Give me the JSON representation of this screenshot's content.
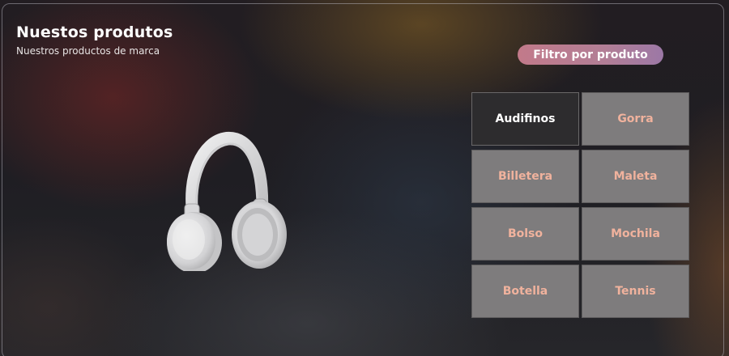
{
  "header": {
    "title": "Nuestos produtos",
    "subtitle": "Nuestros productos de marca"
  },
  "filter_button": {
    "label": "Filtro por produto",
    "gradient": [
      "#c27a8a",
      "#9c78a6"
    ]
  },
  "categories": [
    {
      "label": "Audifinos",
      "active": true
    },
    {
      "label": "Gorra",
      "active": false
    },
    {
      "label": "Billetera",
      "active": false
    },
    {
      "label": "Maleta",
      "active": false
    },
    {
      "label": "Bolso",
      "active": false
    },
    {
      "label": "Mochila",
      "active": false
    },
    {
      "label": "Botella",
      "active": false
    },
    {
      "label": "Tennis",
      "active": false
    }
  ],
  "colors": {
    "category_text": "#f0b29d",
    "category_bg": "#7e7c7d",
    "active_bg": "#2d2c2e"
  },
  "product_image": {
    "icon": "headphones-icon"
  }
}
